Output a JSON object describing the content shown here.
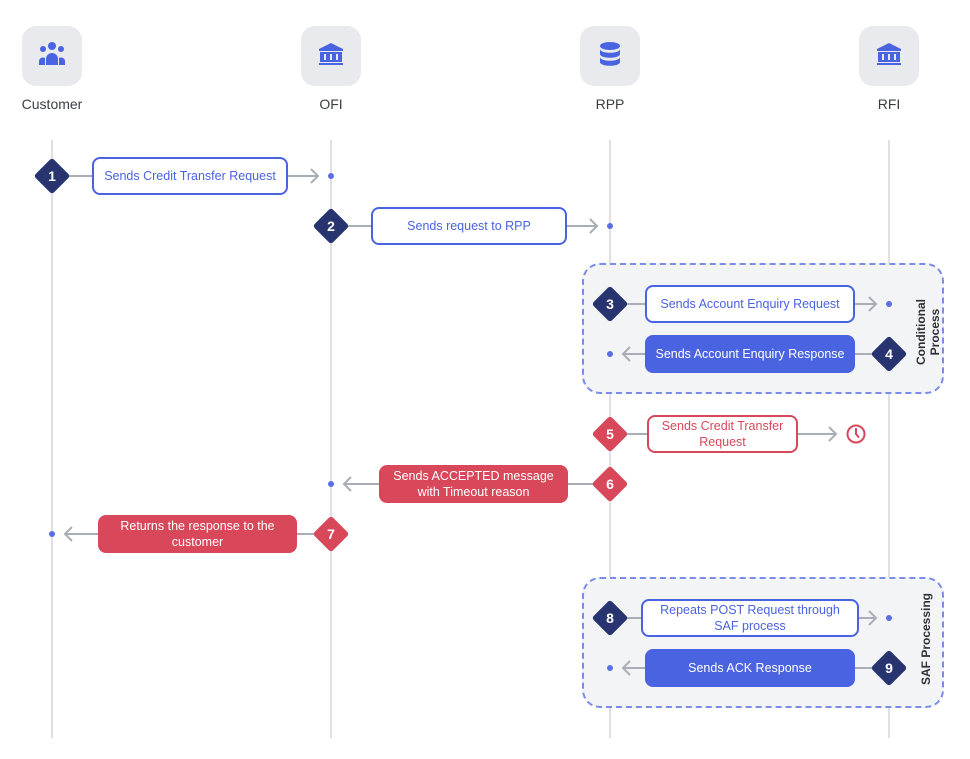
{
  "actors": [
    {
      "name": "Customer",
      "icon": "users-icon"
    },
    {
      "name": "OFI",
      "icon": "bank-icon"
    },
    {
      "name": "RPP",
      "icon": "database-icon"
    },
    {
      "name": "RFI",
      "icon": "bank-icon"
    }
  ],
  "groups": [
    {
      "label_line1": "Conditional",
      "label_line2": "Process"
    },
    {
      "label_line1": "SAF Processing",
      "label_line2": ""
    }
  ],
  "steps": [
    {
      "number": "1",
      "text": "Sends Credit Transfer Request",
      "style": "outline-blue"
    },
    {
      "number": "2",
      "text": "Sends request to RPP",
      "style": "outline-blue"
    },
    {
      "number": "3",
      "text": "Sends Account Enquiry Request",
      "style": "outline-blue"
    },
    {
      "number": "4",
      "text": "Sends Account Enquiry Response",
      "style": "fill-blue"
    },
    {
      "number": "5",
      "text": "Sends Credit Transfer Request",
      "style": "outline-red",
      "end_icon": "clock-icon"
    },
    {
      "number": "6",
      "text": "Sends ACCEPTED message with Timeout reason",
      "style": "fill-red"
    },
    {
      "number": "7",
      "text": "Returns the response to the customer",
      "style": "fill-red"
    },
    {
      "number": "8",
      "text": "Repeats POST Request through SAF process",
      "style": "outline-blue"
    },
    {
      "number": "9",
      "text": "Sends ACK Response",
      "style": "fill-blue"
    }
  ],
  "colors": {
    "navy": "#283470",
    "blue": "#4a63e0",
    "red": "#d9475a",
    "group_border": "#7b8ce8",
    "group_bg": "#f3f4f6"
  }
}
